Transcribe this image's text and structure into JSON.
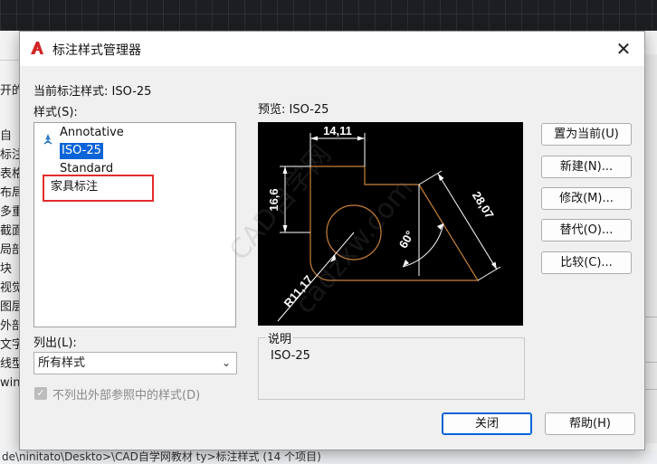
{
  "background": {
    "left_items": [
      "开的",
      "自",
      "标注",
      "表格",
      "布局",
      "多重",
      "截面",
      "局部",
      "块",
      "视觉",
      "图层",
      "外部",
      "文字",
      "线型",
      "win"
    ],
    "status_text": "de\\ninitato\\Deskto>\\CAD自学网教材 ty>标注样式 (14 个项目)"
  },
  "dialog": {
    "title": "标注样式管理器",
    "current_style_label": "当前标注样式:",
    "current_style_value": "ISO-25",
    "styles_label": "样式(S):",
    "styles": [
      "Annotative",
      "ISO-25",
      "Standard",
      "家具标注"
    ],
    "selected_style": "ISO-25",
    "preview_label": "预览:",
    "preview_style": "ISO-25",
    "list_label": "列出(L):",
    "list_value": "所有样式",
    "checkbox_label": "不列出外部参照中的样式(D)",
    "checkbox_checked": true,
    "description_legend": "说明",
    "description_text": "ISO-25",
    "buttons": {
      "set_current": "置为当前(U)",
      "new": "新建(N)...",
      "modify": "修改(M)...",
      "override": "替代(O)...",
      "compare": "比较(C)...",
      "close": "关闭",
      "help": "帮助(H)"
    }
  },
  "preview_drawing": {
    "dim_top": "14,11",
    "dim_left": "16,6",
    "dim_diag": "28,07",
    "dim_angle": "60°",
    "dim_radius": "R11,17"
  },
  "watermark": [
    "CAD自学网",
    "cadzxw.com"
  ],
  "colors": {
    "accent": "#0a64d8",
    "highlight_box": "#e12c2c",
    "geometry": "#c8823a",
    "preview_bg": "#000000"
  }
}
